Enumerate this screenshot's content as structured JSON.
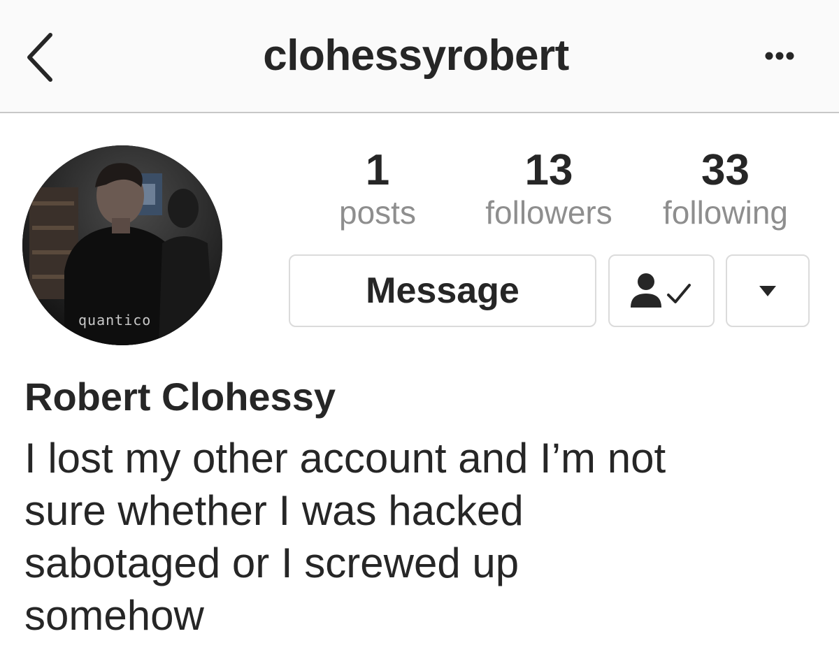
{
  "header": {
    "username": "clohessyrobert",
    "back_icon": "chevron-left-icon",
    "more_icon": "ellipsis-icon"
  },
  "profile": {
    "avatar_caption": "quantico",
    "stats": {
      "posts": {
        "count": "1",
        "label": "posts"
      },
      "followers": {
        "count": "13",
        "label": "followers"
      },
      "following": {
        "count": "33",
        "label": "following"
      }
    },
    "buttons": {
      "message_label": "Message",
      "following_icon": "person-check-icon",
      "dropdown_icon": "caret-down-icon"
    },
    "full_name": "Robert Clohessy",
    "bio_lines": [
      "I lost my other account and I’m not",
      "sure whether I was hacked",
      "sabotaged or I screwed up",
      "somehow"
    ]
  },
  "colors": {
    "text": "#262626",
    "muted": "#8e8e8e",
    "border": "#dbdbdb",
    "header_bg": "#fafafa"
  }
}
